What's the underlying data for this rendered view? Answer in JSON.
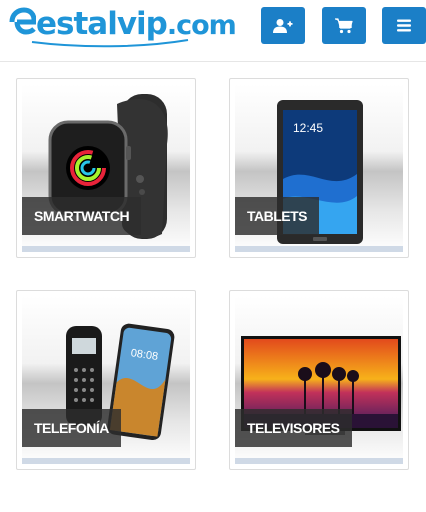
{
  "brand": {
    "name": "estalvip",
    "suffix": ".com",
    "color": "#1f95d8"
  },
  "header": {
    "buttons": [
      {
        "id": "user",
        "icon": "user-plus-icon"
      },
      {
        "id": "cart",
        "icon": "cart-icon"
      },
      {
        "id": "menu",
        "icon": "hamburger-menu-icon"
      }
    ],
    "button_color": "#1b7fc7"
  },
  "categories": [
    {
      "label": "SMARTWATCH",
      "icon": "smartwatch-image"
    },
    {
      "label": "TABLETS",
      "icon": "tablet-image"
    },
    {
      "label": "TELEFONÍA",
      "icon": "phone-image"
    },
    {
      "label": "TELEVISORES",
      "icon": "tv-image"
    }
  ],
  "device_screens": {
    "tablet_clock": "12:45",
    "phone_clock": "08:08"
  }
}
